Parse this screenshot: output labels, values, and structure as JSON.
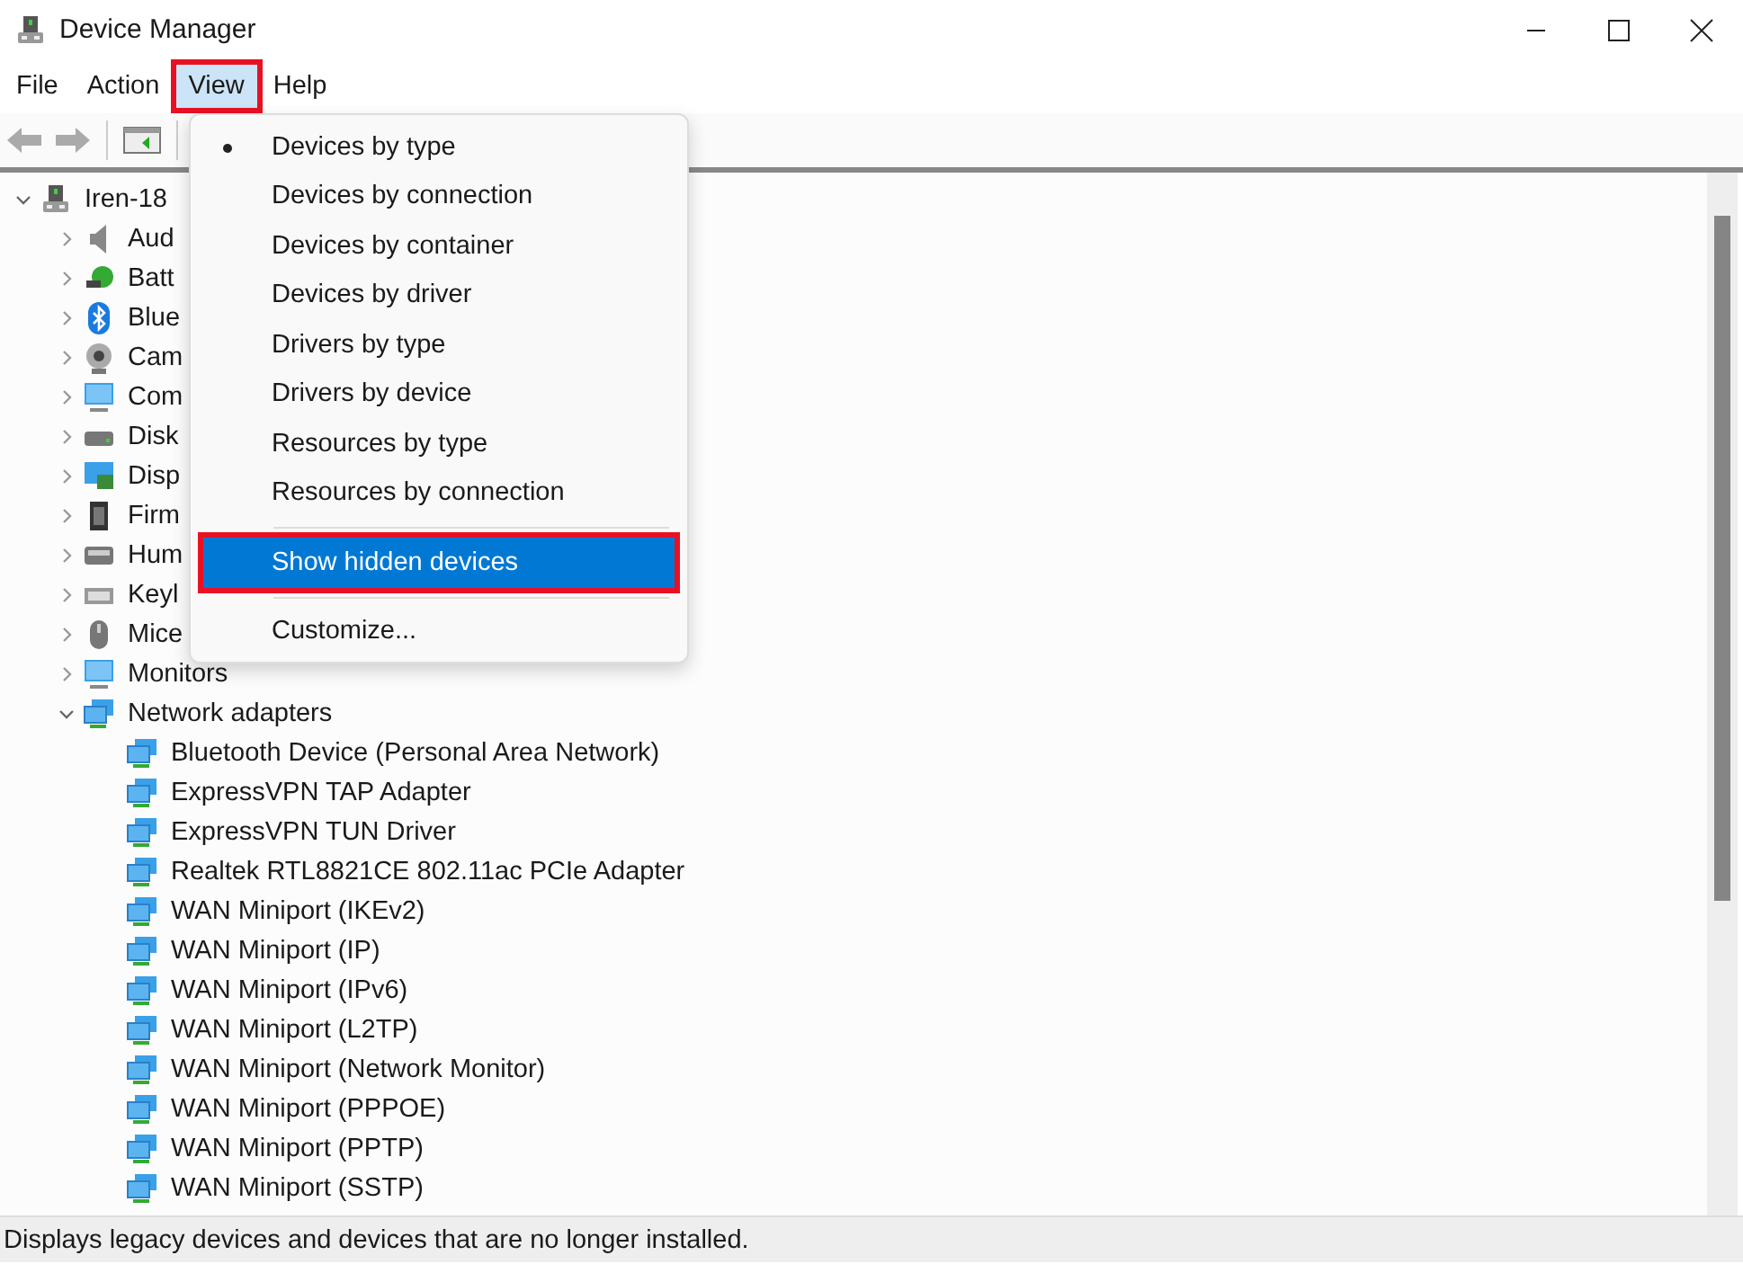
{
  "window": {
    "title": "Device Manager"
  },
  "menu_bar": [
    {
      "label": "File",
      "open": false,
      "outlined": false
    },
    {
      "label": "Action",
      "open": false,
      "outlined": false
    },
    {
      "label": "View",
      "open": true,
      "outlined": true
    },
    {
      "label": "Help",
      "open": false,
      "outlined": false
    }
  ],
  "view_menu": [
    {
      "kind": "item",
      "label": "Devices by type",
      "selected": true,
      "highlighted": false,
      "outlined": false
    },
    {
      "kind": "item",
      "label": "Devices by connection",
      "selected": false,
      "highlighted": false,
      "outlined": false
    },
    {
      "kind": "item",
      "label": "Devices by container",
      "selected": false,
      "highlighted": false,
      "outlined": false
    },
    {
      "kind": "item",
      "label": "Devices by driver",
      "selected": false,
      "highlighted": false,
      "outlined": false
    },
    {
      "kind": "item",
      "label": "Drivers by type",
      "selected": false,
      "highlighted": false,
      "outlined": false
    },
    {
      "kind": "item",
      "label": "Drivers by device",
      "selected": false,
      "highlighted": false,
      "outlined": false
    },
    {
      "kind": "item",
      "label": "Resources by type",
      "selected": false,
      "highlighted": false,
      "outlined": false
    },
    {
      "kind": "item",
      "label": "Resources by connection",
      "selected": false,
      "highlighted": false,
      "outlined": false
    },
    {
      "kind": "separator"
    },
    {
      "kind": "item",
      "label": "Show hidden devices",
      "selected": false,
      "highlighted": true,
      "outlined": true
    },
    {
      "kind": "separator"
    },
    {
      "kind": "item",
      "label": "Customize...",
      "selected": false,
      "highlighted": false,
      "outlined": false
    }
  ],
  "tree": {
    "label": "Iren-18",
    "expanded": true,
    "children": [
      {
        "label": "Aud",
        "expanded": false
      },
      {
        "label": "Batt",
        "expanded": false
      },
      {
        "label": "Blue",
        "expanded": false
      },
      {
        "label": "Cam",
        "expanded": false
      },
      {
        "label": "Com",
        "expanded": false
      },
      {
        "label": "Disk",
        "expanded": false
      },
      {
        "label": "Disp",
        "expanded": false
      },
      {
        "label": "Firm",
        "expanded": false
      },
      {
        "label": "Hum",
        "expanded": false
      },
      {
        "label": "Keyl",
        "expanded": false
      },
      {
        "label": "Mice",
        "expanded": false
      },
      {
        "label": "Monitors",
        "expanded": false
      },
      {
        "label": "Network adapters",
        "expanded": true,
        "children": [
          {
            "label": "Bluetooth Device (Personal Area Network)"
          },
          {
            "label": "ExpressVPN TAP Adapter"
          },
          {
            "label": "ExpressVPN TUN Driver"
          },
          {
            "label": "Realtek RTL8821CE 802.11ac PCIe Adapter"
          },
          {
            "label": "WAN Miniport (IKEv2)"
          },
          {
            "label": "WAN Miniport (IP)"
          },
          {
            "label": "WAN Miniport (IPv6)"
          },
          {
            "label": "WAN Miniport (L2TP)"
          },
          {
            "label": "WAN Miniport (Network Monitor)"
          },
          {
            "label": "WAN Miniport (PPPOE)"
          },
          {
            "label": "WAN Miniport (PPTP)"
          },
          {
            "label": "WAN Miniport (SSTP)"
          }
        ]
      }
    ]
  },
  "status_bar": {
    "text": "Displays legacy devices and devices that are no longer installed."
  }
}
